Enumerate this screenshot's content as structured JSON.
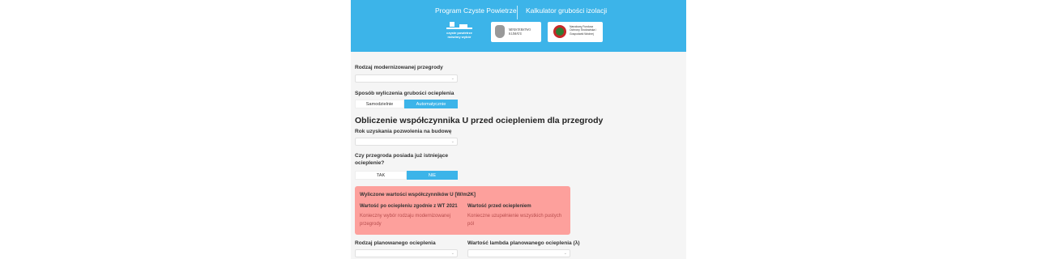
{
  "header": {
    "nav": [
      {
        "label": "Program Czyste Powietrze"
      },
      {
        "label": "Kalkulator grubości izolacji"
      }
    ],
    "logos": {
      "main": "czyste powietrze mówimy wybór",
      "ministry": "MINISTERSTWO KLIMATU",
      "fund": "Narodowy Fundusz Ochrony Środowiska i Gospodarki Wodnej"
    },
    "color": "#3cb4e9"
  },
  "form": {
    "partition_type": {
      "label": "Rodzaj modernizowanej przegrody",
      "value": ""
    },
    "calc_method": {
      "label": "Sposób wyliczenia grubości ocieplenia",
      "options": [
        "Samodzielnie",
        "Automatycznie"
      ],
      "selected": "Automatycznie"
    },
    "section_title": "Obliczenie współczynnika U przed ociepleniem dla przegrody",
    "permit_year": {
      "label": "Rok uzyskania pozwolenia na budowę",
      "value": ""
    },
    "existing_insulation": {
      "label": "Czy przegroda posiada już istniejące ocieplenie?",
      "options": [
        "TAK",
        "NIE"
      ],
      "selected": "NIE"
    },
    "results": {
      "title": "Wyliczone wartości współczynników U [W/m2K]",
      "after": {
        "label": "Wartość po ociepleniu zgodnie z WT 2021",
        "message": "Konieczny wybór rodzaju modernizowanej przegrody"
      },
      "before": {
        "label": "Wartość przed ociepleniem",
        "message": "Konieczne uzupełnienie wszystkich pustych pól"
      }
    },
    "planned_insulation": {
      "label": "Rodzaj planowanego ocieplenia",
      "value": ""
    },
    "lambda": {
      "label": "Wartość lambda planowanego ocieplenia (λ)",
      "value": ""
    }
  },
  "colors": {
    "accent": "#3cb4e9",
    "alert_bg": "#fda09c",
    "alert_text": "#b74d4d"
  }
}
